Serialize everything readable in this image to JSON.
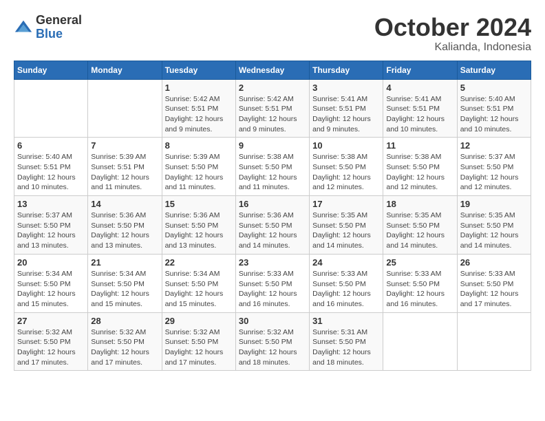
{
  "logo": {
    "general": "General",
    "blue": "Blue"
  },
  "title": "October 2024",
  "location": "Kalianda, Indonesia",
  "headers": [
    "Sunday",
    "Monday",
    "Tuesday",
    "Wednesday",
    "Thursday",
    "Friday",
    "Saturday"
  ],
  "weeks": [
    [
      {
        "day": "",
        "info": ""
      },
      {
        "day": "",
        "info": ""
      },
      {
        "day": "1",
        "info": "Sunrise: 5:42 AM\nSunset: 5:51 PM\nDaylight: 12 hours and 9 minutes."
      },
      {
        "day": "2",
        "info": "Sunrise: 5:42 AM\nSunset: 5:51 PM\nDaylight: 12 hours and 9 minutes."
      },
      {
        "day": "3",
        "info": "Sunrise: 5:41 AM\nSunset: 5:51 PM\nDaylight: 12 hours and 9 minutes."
      },
      {
        "day": "4",
        "info": "Sunrise: 5:41 AM\nSunset: 5:51 PM\nDaylight: 12 hours and 10 minutes."
      },
      {
        "day": "5",
        "info": "Sunrise: 5:40 AM\nSunset: 5:51 PM\nDaylight: 12 hours and 10 minutes."
      }
    ],
    [
      {
        "day": "6",
        "info": "Sunrise: 5:40 AM\nSunset: 5:51 PM\nDaylight: 12 hours and 10 minutes."
      },
      {
        "day": "7",
        "info": "Sunrise: 5:39 AM\nSunset: 5:51 PM\nDaylight: 12 hours and 11 minutes."
      },
      {
        "day": "8",
        "info": "Sunrise: 5:39 AM\nSunset: 5:50 PM\nDaylight: 12 hours and 11 minutes."
      },
      {
        "day": "9",
        "info": "Sunrise: 5:38 AM\nSunset: 5:50 PM\nDaylight: 12 hours and 11 minutes."
      },
      {
        "day": "10",
        "info": "Sunrise: 5:38 AM\nSunset: 5:50 PM\nDaylight: 12 hours and 12 minutes."
      },
      {
        "day": "11",
        "info": "Sunrise: 5:38 AM\nSunset: 5:50 PM\nDaylight: 12 hours and 12 minutes."
      },
      {
        "day": "12",
        "info": "Sunrise: 5:37 AM\nSunset: 5:50 PM\nDaylight: 12 hours and 12 minutes."
      }
    ],
    [
      {
        "day": "13",
        "info": "Sunrise: 5:37 AM\nSunset: 5:50 PM\nDaylight: 12 hours and 13 minutes."
      },
      {
        "day": "14",
        "info": "Sunrise: 5:36 AM\nSunset: 5:50 PM\nDaylight: 12 hours and 13 minutes."
      },
      {
        "day": "15",
        "info": "Sunrise: 5:36 AM\nSunset: 5:50 PM\nDaylight: 12 hours and 13 minutes."
      },
      {
        "day": "16",
        "info": "Sunrise: 5:36 AM\nSunset: 5:50 PM\nDaylight: 12 hours and 14 minutes."
      },
      {
        "day": "17",
        "info": "Sunrise: 5:35 AM\nSunset: 5:50 PM\nDaylight: 12 hours and 14 minutes."
      },
      {
        "day": "18",
        "info": "Sunrise: 5:35 AM\nSunset: 5:50 PM\nDaylight: 12 hours and 14 minutes."
      },
      {
        "day": "19",
        "info": "Sunrise: 5:35 AM\nSunset: 5:50 PM\nDaylight: 12 hours and 14 minutes."
      }
    ],
    [
      {
        "day": "20",
        "info": "Sunrise: 5:34 AM\nSunset: 5:50 PM\nDaylight: 12 hours and 15 minutes."
      },
      {
        "day": "21",
        "info": "Sunrise: 5:34 AM\nSunset: 5:50 PM\nDaylight: 12 hours and 15 minutes."
      },
      {
        "day": "22",
        "info": "Sunrise: 5:34 AM\nSunset: 5:50 PM\nDaylight: 12 hours and 15 minutes."
      },
      {
        "day": "23",
        "info": "Sunrise: 5:33 AM\nSunset: 5:50 PM\nDaylight: 12 hours and 16 minutes."
      },
      {
        "day": "24",
        "info": "Sunrise: 5:33 AM\nSunset: 5:50 PM\nDaylight: 12 hours and 16 minutes."
      },
      {
        "day": "25",
        "info": "Sunrise: 5:33 AM\nSunset: 5:50 PM\nDaylight: 12 hours and 16 minutes."
      },
      {
        "day": "26",
        "info": "Sunrise: 5:33 AM\nSunset: 5:50 PM\nDaylight: 12 hours and 17 minutes."
      }
    ],
    [
      {
        "day": "27",
        "info": "Sunrise: 5:32 AM\nSunset: 5:50 PM\nDaylight: 12 hours and 17 minutes."
      },
      {
        "day": "28",
        "info": "Sunrise: 5:32 AM\nSunset: 5:50 PM\nDaylight: 12 hours and 17 minutes."
      },
      {
        "day": "29",
        "info": "Sunrise: 5:32 AM\nSunset: 5:50 PM\nDaylight: 12 hours and 17 minutes."
      },
      {
        "day": "30",
        "info": "Sunrise: 5:32 AM\nSunset: 5:50 PM\nDaylight: 12 hours and 18 minutes."
      },
      {
        "day": "31",
        "info": "Sunrise: 5:31 AM\nSunset: 5:50 PM\nDaylight: 12 hours and 18 minutes."
      },
      {
        "day": "",
        "info": ""
      },
      {
        "day": "",
        "info": ""
      }
    ]
  ]
}
